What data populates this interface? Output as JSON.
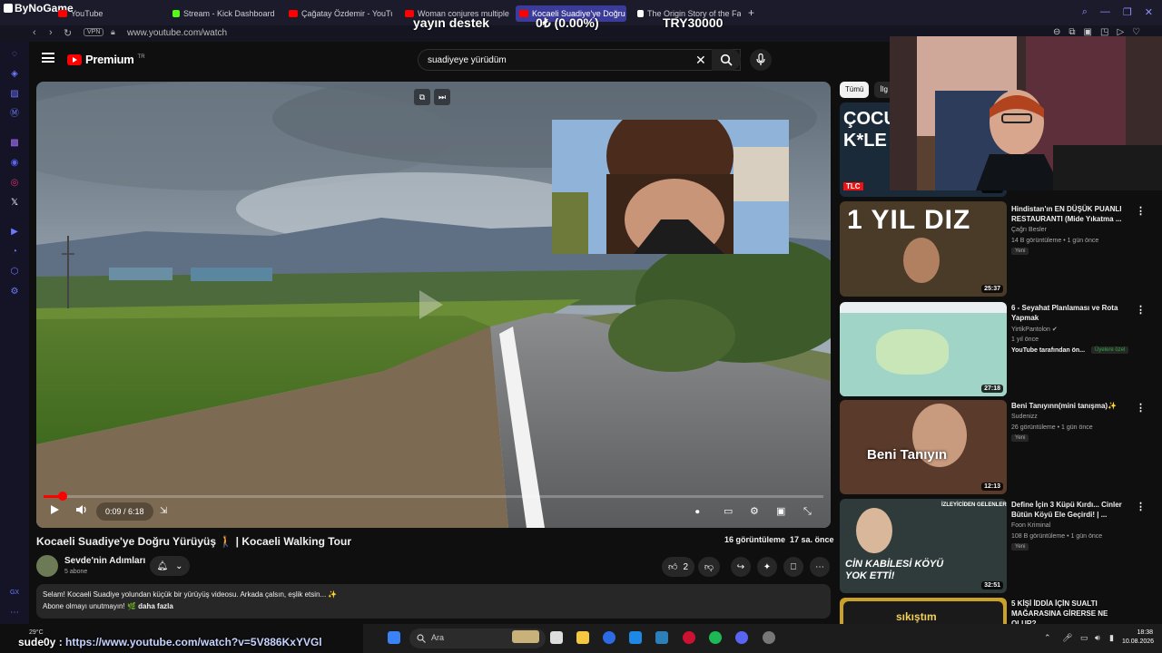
{
  "browser": {
    "brand": "ByNoGame",
    "tabs": [
      {
        "label": "YouTube",
        "fav_color": "#ff0000"
      },
      {
        "label": "Stream - Kick Dashboard",
        "fav_color": "#53fc18"
      },
      {
        "label": "Çağatay Özdemir - YouTu",
        "fav_color": "#ff0000"
      },
      {
        "label": "Woman conjures multiple p",
        "fav_color": "#ff0000"
      },
      {
        "label": "Kocaeli Suadiye'ye Doğru",
        "fav_color": "#ff0000"
      },
      {
        "label": "The Origin Story of the Fam",
        "fav_color": "#ffffff"
      }
    ],
    "add_tab": "+",
    "vpn": "VPN",
    "url": "www.youtube.com/watch"
  },
  "stream_overlay": {
    "label": "yayın destek",
    "progress": "0₺ (0.00%)",
    "goal": "TRY30000"
  },
  "youtube": {
    "brand": "Premium",
    "region": "TR",
    "search": {
      "value": "suadiyeye yürüdüm"
    }
  },
  "player": {
    "time": "0:09 / 6:18",
    "played_fraction": 0.024
  },
  "video": {
    "title": "Kocaeli Suadiye'ye Doğru Yürüyüş 🚶 | Kocaeli Walking Tour",
    "views": "16 görüntüleme",
    "age": "17 sa. önce",
    "channel": "Sevde'nin Adımları",
    "subs": "5 abone",
    "likes": "2",
    "desc_line1": "Selam! Kocaeli Suadiye yolundan küçük bir yürüyüş videosu. Arkada çalsın, eşlik etsin... ✨",
    "desc_line2": "Abone olmayı unutmayın! 🌿",
    "more": "daha fazla"
  },
  "chips": [
    "Tümü",
    "İlg"
  ],
  "related": [
    {
      "thumb_text": "ÇOCU K*LE",
      "duration": "22:06"
    },
    {
      "title": "Hindistan'ın EN DÜŞÜK PUANLI RESTAURANTI (Mide Yıkatma ...",
      "channel": "Çağrı Besler",
      "meta": "14 B görüntüleme • 1 gün önce",
      "badge": "Yeni",
      "thumb_text": "1 YIL DIZ",
      "duration": "25:37"
    },
    {
      "title": "6 - Seyahat Planlaması ve Rota Yapmak",
      "channel": "YirtikPantolon",
      "meta": "1 yıl önce",
      "extra": "YouTube tarafından ön...",
      "members": "Üyelere özel",
      "duration": "27:18"
    },
    {
      "title": "Beni Tanıyınn(mini tanışma)✨",
      "channel": "Sudenizz",
      "meta": "26 görüntüleme • 1 gün önce",
      "badge": "Yeni",
      "thumb_text": "Beni Tanıyın",
      "duration": "12:13"
    },
    {
      "title": "Define İçin 3 Küpü Kırdı... Cinler Bütün Köyü Ele Geçirdi! | ...",
      "channel": "Foon Kriminal",
      "meta": "108 B görüntüleme • 1 gün önce",
      "badge": "Yeni",
      "thumb_text": "CİN KABİLESİ KÖYÜ YOK ETTİ!",
      "thumb_top": "İZLEYİCİDEN GELENLER",
      "duration": "32:51"
    },
    {
      "title": "5 KİŞİ İDDİA İÇİN SUALTI MAĞARASINA GİRERSE NE OLUR?",
      "thumb_text": "sıkıştım"
    }
  ],
  "chat": {
    "user": "sude0y :",
    "link": "https://www.youtube.com/watch?v=5V886KxYVGl"
  },
  "taskbar": {
    "weather": "29°C",
    "search": "Ara",
    "time": "18:38",
    "date": "10.08.2026"
  },
  "colors": {
    "accent_red": "#ff0000",
    "bg": "#0f0f0f",
    "panel": "#272727"
  }
}
